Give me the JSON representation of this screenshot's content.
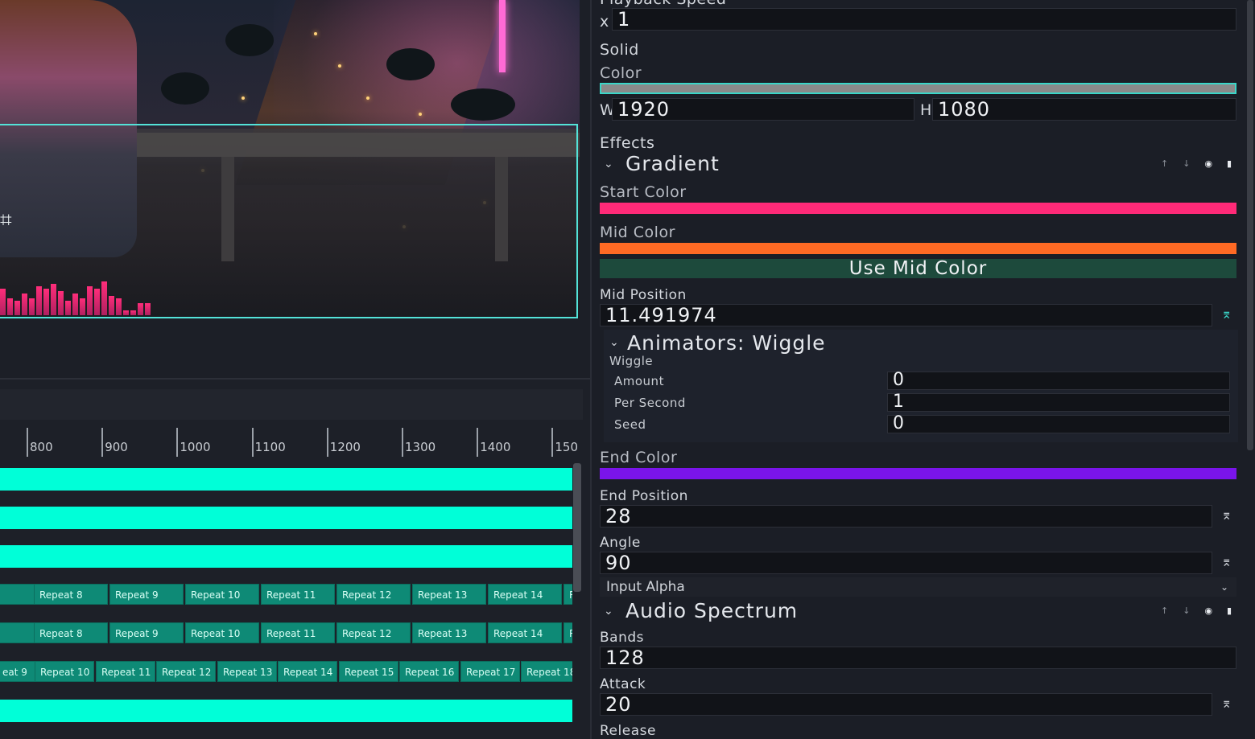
{
  "preview": {
    "crosshair_icon": "crosshair-icon",
    "spectrum_levels": [
      0.55,
      0.35,
      0.3,
      0.45,
      0.35,
      0.6,
      0.55,
      0.65,
      0.5,
      0.3,
      0.45,
      0.35,
      0.6,
      0.55,
      0.7,
      0.4,
      0.35,
      0.1,
      0.1,
      0.25,
      0.25
    ]
  },
  "timeline": {
    "ruler_ticks": [
      "800",
      "900",
      "1000",
      "1100",
      "1200",
      "1300",
      "1400",
      "150"
    ],
    "clip_row_1": [
      "7",
      "Repeat 8",
      "Repeat 9",
      "Repeat 10",
      "Repeat 11",
      "Repeat 12",
      "Repeat 13",
      "Repeat 14",
      "R"
    ],
    "clip_row_2": [
      "7",
      "Repeat 8",
      "Repeat 9",
      "Repeat 10",
      "Repeat 11",
      "Repeat 12",
      "Repeat 13",
      "Repeat 14",
      "R"
    ],
    "clip_row_3": [
      "eat 9",
      "Repeat 10",
      "Repeat 11",
      "Repeat 12",
      "Repeat 13",
      "Repeat 14",
      "Repeat 15",
      "Repeat 16",
      "Repeat 17",
      "Repeat 18"
    ],
    "track_color": "#00ffd8",
    "clip_color": "#0e8a76"
  },
  "panel": {
    "playback_speed_label": "Playback Speed",
    "speed_prefix": "x",
    "speed_value": "1",
    "solid_label": "Solid",
    "color_label": "Color",
    "solid_color": "#8a8a8a",
    "w_label": "W",
    "w_value": "1920",
    "h_label": "H",
    "h_value": "1080",
    "effects_label": "Effects",
    "gradient": {
      "title": "Gradient",
      "start_color_label": "Start Color",
      "start_color": "#ff2a78",
      "mid_color_label": "Mid Color",
      "mid_color": "#ff6a24",
      "use_mid_color_button": "Use Mid Color",
      "mid_position_label": "Mid Position",
      "mid_position_value": "11.491974",
      "animators_title": "Animators: Wiggle",
      "wiggle_label": "Wiggle",
      "amount_label": "Amount",
      "amount_value": "0",
      "per_second_label": "Per Second",
      "per_second_value": "1",
      "seed_label": "Seed",
      "seed_value": "0",
      "end_color_label": "End Color",
      "end_color": "#7a14ea",
      "end_position_label": "End Position",
      "end_position_value": "28",
      "angle_label": "Angle",
      "angle_value": "90",
      "input_alpha_label": "Input Alpha"
    },
    "audio_spectrum": {
      "title": "Audio Spectrum",
      "bands_label": "Bands",
      "bands_value": "128",
      "attack_label": "Attack",
      "attack_value": "20",
      "release_label": "Release"
    },
    "accent_color": "#3ad6c8",
    "icons": {
      "up": "arrow-up-icon",
      "down": "arrow-down-icon",
      "eye": "eye-icon",
      "trash": "trash-icon",
      "chevron": "chevron-down-icon",
      "animate": "animate-icon"
    }
  }
}
